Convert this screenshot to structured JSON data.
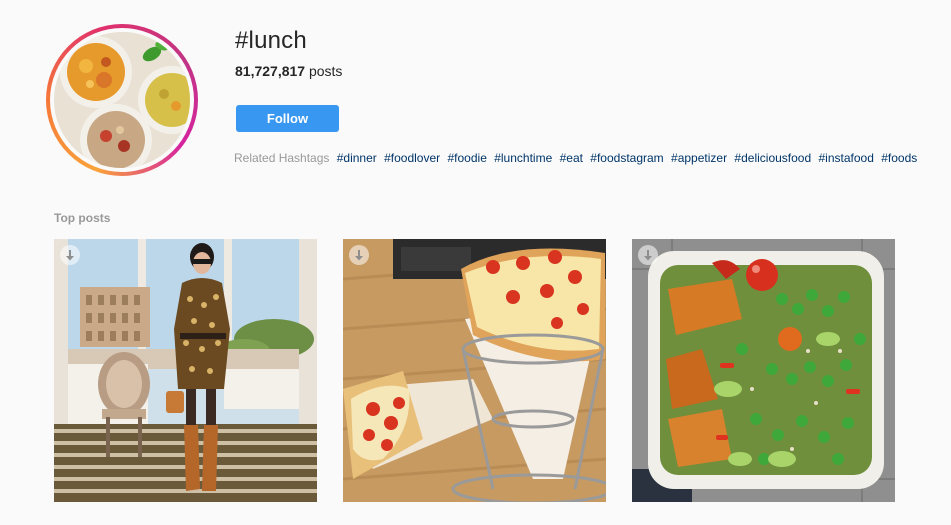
{
  "hashtag": {
    "title": "#lunch",
    "post_count": "81,727,817",
    "post_count_suffix": " posts",
    "follow_label": "Follow"
  },
  "related": {
    "label": "Related Hashtags",
    "tags": [
      "#dinner",
      "#foodlover",
      "#foodie",
      "#lunchtime",
      "#eat",
      "#foodstagram",
      "#appetizer",
      "#deliciousfood",
      "#instafood",
      "#foods"
    ]
  },
  "top_posts": {
    "label": "Top posts",
    "posts": [
      {
        "subject": "woman in patterned dress by window with Colosseum view"
      },
      {
        "subject": "pizza cones in metal stand"
      },
      {
        "subject": "salad bowl with peas, tomatoes and roasted squash"
      }
    ]
  },
  "colors": {
    "follow_button": "#3897f0",
    "hashtag_link": "#003569",
    "muted_text": "#999999",
    "background": "#fafafa"
  }
}
